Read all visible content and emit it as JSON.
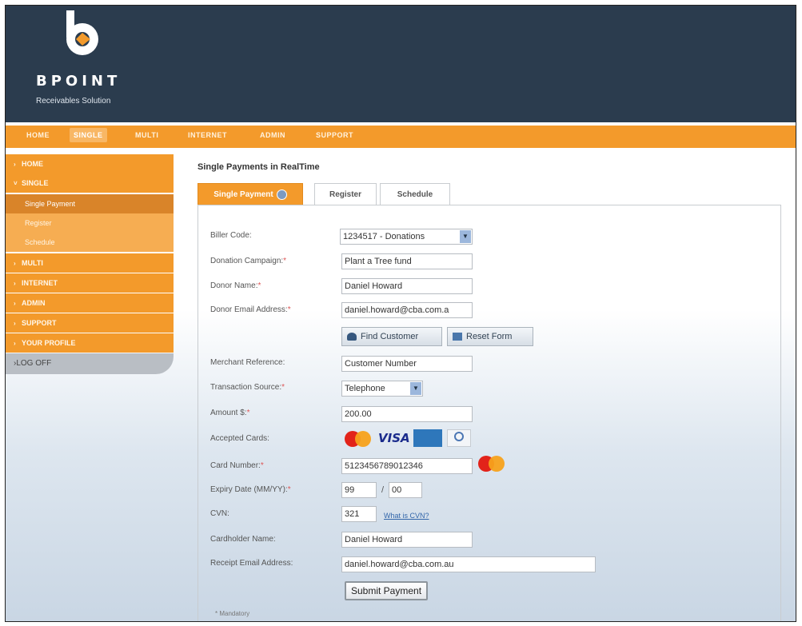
{
  "brand": {
    "name": "BPOINT",
    "tagline": "Receivables Solution"
  },
  "topnav": [
    "HOME",
    "SINGLE",
    "MULTI",
    "INTERNET",
    "ADMIN",
    "SUPPORT"
  ],
  "topnav_active": "SINGLE",
  "sidebar": {
    "items": [
      {
        "label": "HOME"
      },
      {
        "label": "SINGLE"
      }
    ],
    "subitems": [
      {
        "label": "Single Payment",
        "active": true
      },
      {
        "label": "Register"
      },
      {
        "label": "Schedule"
      }
    ],
    "items_after": [
      {
        "label": "MULTI"
      },
      {
        "label": "INTERNET"
      },
      {
        "label": "ADMIN"
      },
      {
        "label": "SUPPORT"
      },
      {
        "label": "YOUR PROFILE"
      }
    ],
    "logoff": "LOG OFF"
  },
  "page": {
    "title": "Single Payments in RealTime"
  },
  "tabs": [
    {
      "label": "Single Payment",
      "active": true
    },
    {
      "label": "Register"
    },
    {
      "label": "Schedule"
    }
  ],
  "form": {
    "biller_code": {
      "label": "Biller Code:",
      "value": "1234517 - Donations"
    },
    "donation_campaign": {
      "label": "Donation Campaign:",
      "value": "Plant a Tree fund"
    },
    "donor_name": {
      "label": "Donor Name:",
      "value": "Daniel Howard"
    },
    "donor_email": {
      "label": "Donor Email Address:",
      "value": "daniel.howard@cba.com.a"
    },
    "find_customer": "Find Customer",
    "reset_form": "Reset Form",
    "merchant_reference": {
      "label": "Merchant Reference:",
      "value": "Customer Number"
    },
    "transaction_source": {
      "label": "Transaction Source:",
      "value": "Telephone"
    },
    "amount": {
      "label": "Amount $:",
      "value": "200.00"
    },
    "accepted_cards": {
      "label": "Accepted Cards:",
      "cards": [
        "mastercard",
        "VISA",
        "amex",
        "diners"
      ]
    },
    "card_number": {
      "label": "Card Number:",
      "value": "5123456789012346"
    },
    "expiry": {
      "label": "Expiry Date (MM/YY):",
      "month": "99",
      "separator": "/",
      "year": "00"
    },
    "cvn": {
      "label": "CVN:",
      "value": "321",
      "help_link": "What is CVN?"
    },
    "cardholder_name": {
      "label": "Cardholder Name:",
      "value": "Daniel Howard"
    },
    "receipt_email": {
      "label": "Receipt Email Address:",
      "value": "daniel.howard@cba.com.au"
    },
    "submit": "Submit Payment",
    "required_marker": "*",
    "mandatory_note": "* Mandatory"
  },
  "colors": {
    "header_bg": "#2b3c4e",
    "accent_orange": "#f39a2b"
  }
}
